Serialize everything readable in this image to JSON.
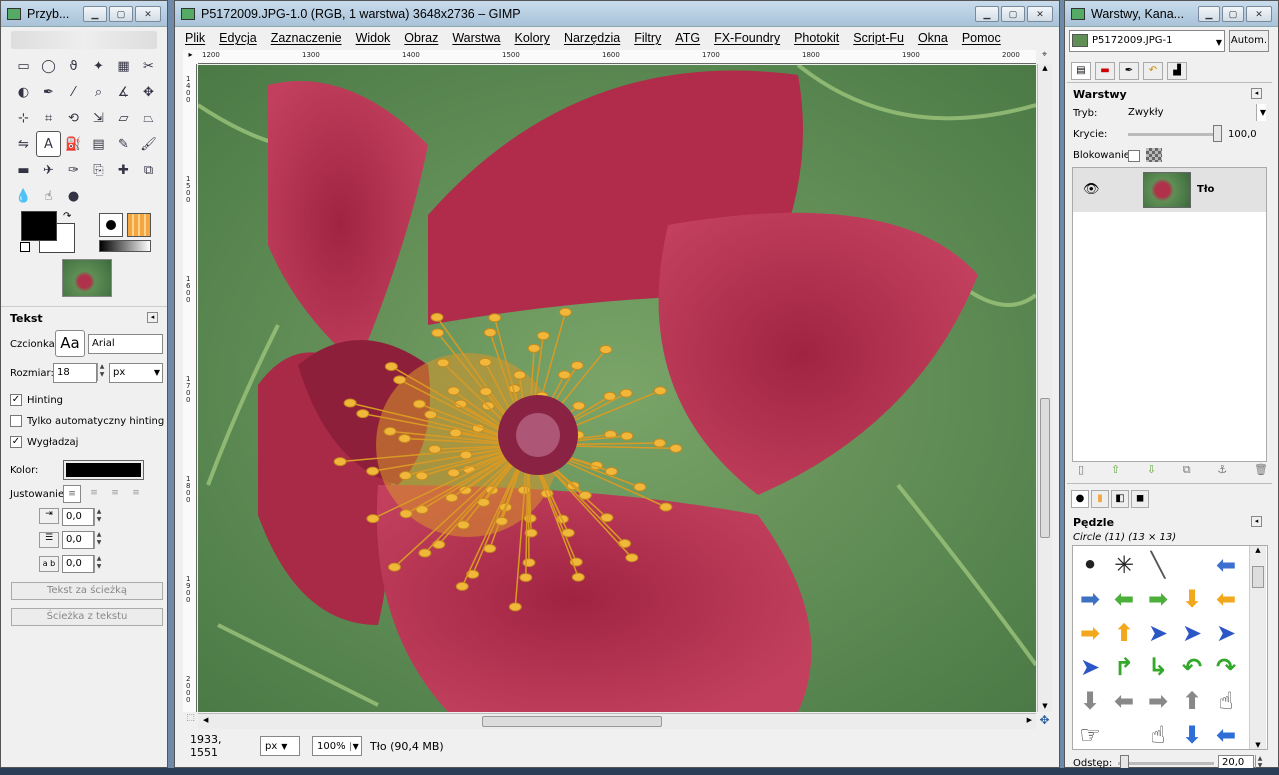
{
  "toolbox": {
    "title": "Przyb...",
    "tools": [
      {
        "name": "rect-select-icon",
        "glyph": "▭"
      },
      {
        "name": "ellipse-select-icon",
        "glyph": "◯"
      },
      {
        "name": "free-select-icon",
        "glyph": "ϑ"
      },
      {
        "name": "fuzzy-select-icon",
        "glyph": "✦"
      },
      {
        "name": "color-select-icon",
        "glyph": "▦"
      },
      {
        "name": "scissors-icon",
        "glyph": "✂"
      },
      {
        "name": "foreground-select-icon",
        "glyph": "◐"
      },
      {
        "name": "paths-icon",
        "glyph": "✒"
      },
      {
        "name": "color-picker-icon",
        "glyph": "⁄"
      },
      {
        "name": "zoom-icon",
        "glyph": "⌕"
      },
      {
        "name": "measure-icon",
        "glyph": "∡"
      },
      {
        "name": "move-icon",
        "glyph": "✥"
      },
      {
        "name": "align-icon",
        "glyph": "⊹"
      },
      {
        "name": "crop-icon",
        "glyph": "⌗"
      },
      {
        "name": "rotate-icon",
        "glyph": "⟲"
      },
      {
        "name": "scale-icon",
        "glyph": "⇲"
      },
      {
        "name": "shear-icon",
        "glyph": "▱"
      },
      {
        "name": "perspective-icon",
        "glyph": "⏢"
      },
      {
        "name": "flip-icon",
        "glyph": "⇋"
      },
      {
        "name": "text-icon",
        "glyph": "A",
        "selected": true
      },
      {
        "name": "bucket-fill-icon",
        "glyph": "⛽"
      },
      {
        "name": "blend-icon",
        "glyph": "▤"
      },
      {
        "name": "pencil-icon",
        "glyph": "✎"
      },
      {
        "name": "paintbrush-icon",
        "glyph": "🖌"
      },
      {
        "name": "eraser-icon",
        "glyph": "▬"
      },
      {
        "name": "airbrush-icon",
        "glyph": "✈"
      },
      {
        "name": "ink-icon",
        "glyph": "✑"
      },
      {
        "name": "clone-icon",
        "glyph": "⎘"
      },
      {
        "name": "heal-icon",
        "glyph": "✚"
      },
      {
        "name": "perspective-clone-icon",
        "glyph": "⧉"
      },
      {
        "name": "blur-icon",
        "glyph": "💧"
      },
      {
        "name": "smudge-icon",
        "glyph": "☝"
      },
      {
        "name": "dodge-burn-icon",
        "glyph": "●"
      }
    ],
    "text_options": {
      "title": "Tekst",
      "font_label": "Czcionka:",
      "font_preview": "Aa",
      "font_value": "Arial",
      "size_label": "Rozmiar:",
      "size_value": "18",
      "size_unit": "px",
      "hinting": "Hinting",
      "autohint": "Tylko automatyczny hinting",
      "antialias": "Wygładzaj",
      "color_label": "Kolor:",
      "justify_label": "Justowanie:",
      "indent_value": "0,0",
      "line_spacing_value": "0,0",
      "letter_spacing_value": "0,0",
      "letter_label": "a b",
      "text_along_path": "Tekst za ścieżką",
      "path_from_text": "Ścieżka z tekstu"
    }
  },
  "image_window": {
    "title": "P5172009.JPG-1.0 (RGB, 1 warstwa) 3648x2736 – GIMP",
    "menus": [
      "Plik",
      "Edycja",
      "Zaznaczenie",
      "Widok",
      "Obraz",
      "Warstwa",
      "Kolory",
      "Narzędzia",
      "Filtry",
      "ATG",
      "FX-Foundry",
      "Photokit",
      "Script-Fu",
      "Okna",
      "Pomoc"
    ],
    "ruler_h": [
      "1200",
      "1300",
      "1400",
      "1500",
      "1600",
      "1700",
      "1800",
      "1900",
      "2000"
    ],
    "ruler_v": [
      "1400",
      "1500",
      "1600",
      "1700",
      "1800",
      "1900",
      "2000"
    ],
    "coords": "1933, 1551",
    "unit": "px",
    "zoom": "100%",
    "layer_info": "Tło (90,4 MB)"
  },
  "dock": {
    "title": "Warstwy, Kana...",
    "image_select": "P5172009.JPG-1",
    "auto_button": "Autom.",
    "layers": {
      "title": "Warstwy",
      "mode_label": "Tryb:",
      "mode_value": "Zwykły",
      "opacity_label": "Krycie:",
      "opacity_value": "100,0",
      "lock_label": "Blokowanie:",
      "layer_name": "Tło"
    },
    "brushes": {
      "title": "Pędzle",
      "current": "Circle (11) (13 × 13)",
      "spacing_label": "Odstęp:",
      "spacing_value": "20,0",
      "items": [
        {
          "g": "•",
          "c": "#222"
        },
        {
          "g": "✳",
          "c": "#222"
        },
        {
          "g": "╲",
          "c": "#555"
        },
        {
          "g": "",
          "c": "#000"
        },
        {
          "g": "⬅",
          "c": "#3b6fd0"
        },
        {
          "g": "➡",
          "c": "#3d72c2"
        },
        {
          "g": "⬅",
          "c": "#4caf3a"
        },
        {
          "g": "➡",
          "c": "#4caf3a"
        },
        {
          "g": "⬇",
          "c": "#f2a81d"
        },
        {
          "g": "⬅",
          "c": "#f2a81d"
        },
        {
          "g": "➡",
          "c": "#f2a81d"
        },
        {
          "g": "⬆",
          "c": "#f2a81d"
        },
        {
          "g": "➤",
          "c": "#2b57c6"
        },
        {
          "g": "➤",
          "c": "#2b57c6"
        },
        {
          "g": "➤",
          "c": "#2b57c6"
        },
        {
          "g": "➤",
          "c": "#2b57c6"
        },
        {
          "g": "↱",
          "c": "#33a82b"
        },
        {
          "g": "↳",
          "c": "#33a82b"
        },
        {
          "g": "↶",
          "c": "#33a82b"
        },
        {
          "g": "↷",
          "c": "#33a82b"
        },
        {
          "g": "⬇",
          "c": "#888"
        },
        {
          "g": "⬅",
          "c": "#888"
        },
        {
          "g": "➡",
          "c": "#888"
        },
        {
          "g": "⬆",
          "c": "#888"
        },
        {
          "g": "☝",
          "c": "#333"
        },
        {
          "g": "☞",
          "c": "#333"
        },
        {
          "g": "",
          "c": "#333"
        },
        {
          "g": "☝",
          "c": "#333"
        },
        {
          "g": "⬇",
          "c": "#2f6ed6"
        },
        {
          "g": "⬅",
          "c": "#2f6ed6"
        }
      ]
    }
  }
}
